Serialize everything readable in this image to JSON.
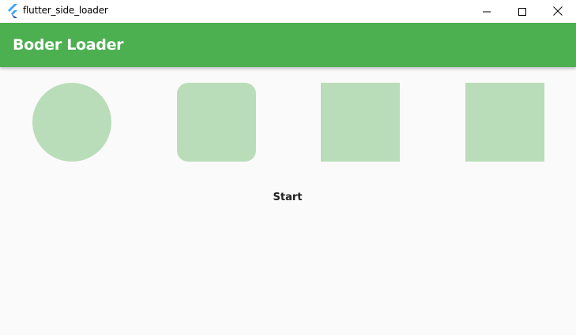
{
  "window": {
    "title": "flutter_side_loader"
  },
  "appbar": {
    "title": "Boder Loader",
    "color": "#4caf50"
  },
  "shapes": [
    {
      "kind": "circle"
    },
    {
      "kind": "rounded-square"
    },
    {
      "kind": "square"
    },
    {
      "kind": "square"
    }
  ],
  "shape_color": "#b9ddb9",
  "start_button": {
    "label": "Start"
  },
  "icons": {
    "app": "flutter-logo-icon",
    "minimize": "minimize-icon",
    "maximize": "maximize-icon",
    "close": "close-icon"
  }
}
